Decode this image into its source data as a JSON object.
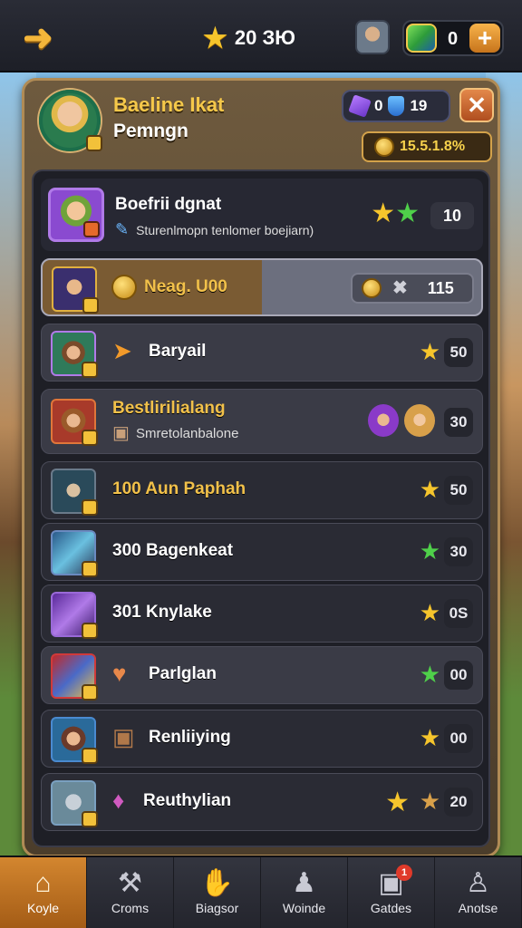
{
  "top_bar": {
    "back_icon": "back-arrow-icon",
    "star_label": "20 ЗЮ",
    "currency_value": "0",
    "plus_label": "+"
  },
  "profile": {
    "name": "Baeline Ikat",
    "subtitle": "Pemngn",
    "resource_a": "0",
    "resource_b": "19",
    "close_label": "✕",
    "gold_value": "15.5.1.8%"
  },
  "featured": {
    "title": "Boefrii dgnat",
    "subtitle": "Sturenlmopn tenlomer boejiarn)",
    "value": "10"
  },
  "rows": [
    {
      "label": "Neag. U00",
      "box_value": "115"
    },
    {
      "label": "Baryail",
      "value": "50"
    },
    {
      "label": "Bestlirilialang",
      "sub": "Smretolanbalone",
      "value": "30"
    },
    {
      "label": "100 Aun Paphah",
      "value": "50"
    },
    {
      "label": "300 Bagenkeat",
      "value": "30"
    },
    {
      "label": "301 Knylake",
      "value": "0Ѕ"
    },
    {
      "label": "Parlglan",
      "value": "00"
    },
    {
      "label": "Renliiying",
      "value": "00"
    },
    {
      "label": "Reuthylian",
      "value": "20"
    }
  ],
  "nav": [
    {
      "label": "Koyle",
      "icon": "home-icon"
    },
    {
      "label": "Croms",
      "icon": "hammer-icon"
    },
    {
      "label": "Biagsor",
      "icon": "hand-icon"
    },
    {
      "label": "Woinde",
      "icon": "helmet-icon"
    },
    {
      "label": "Gatdes",
      "icon": "chest-icon",
      "badge": "1"
    },
    {
      "label": "Anotse",
      "icon": "character-icon"
    }
  ],
  "colors": {
    "accent_gold": "#f2c14a",
    "panel_brown": "#6e5a3e",
    "nav_active": "#d3862f"
  }
}
